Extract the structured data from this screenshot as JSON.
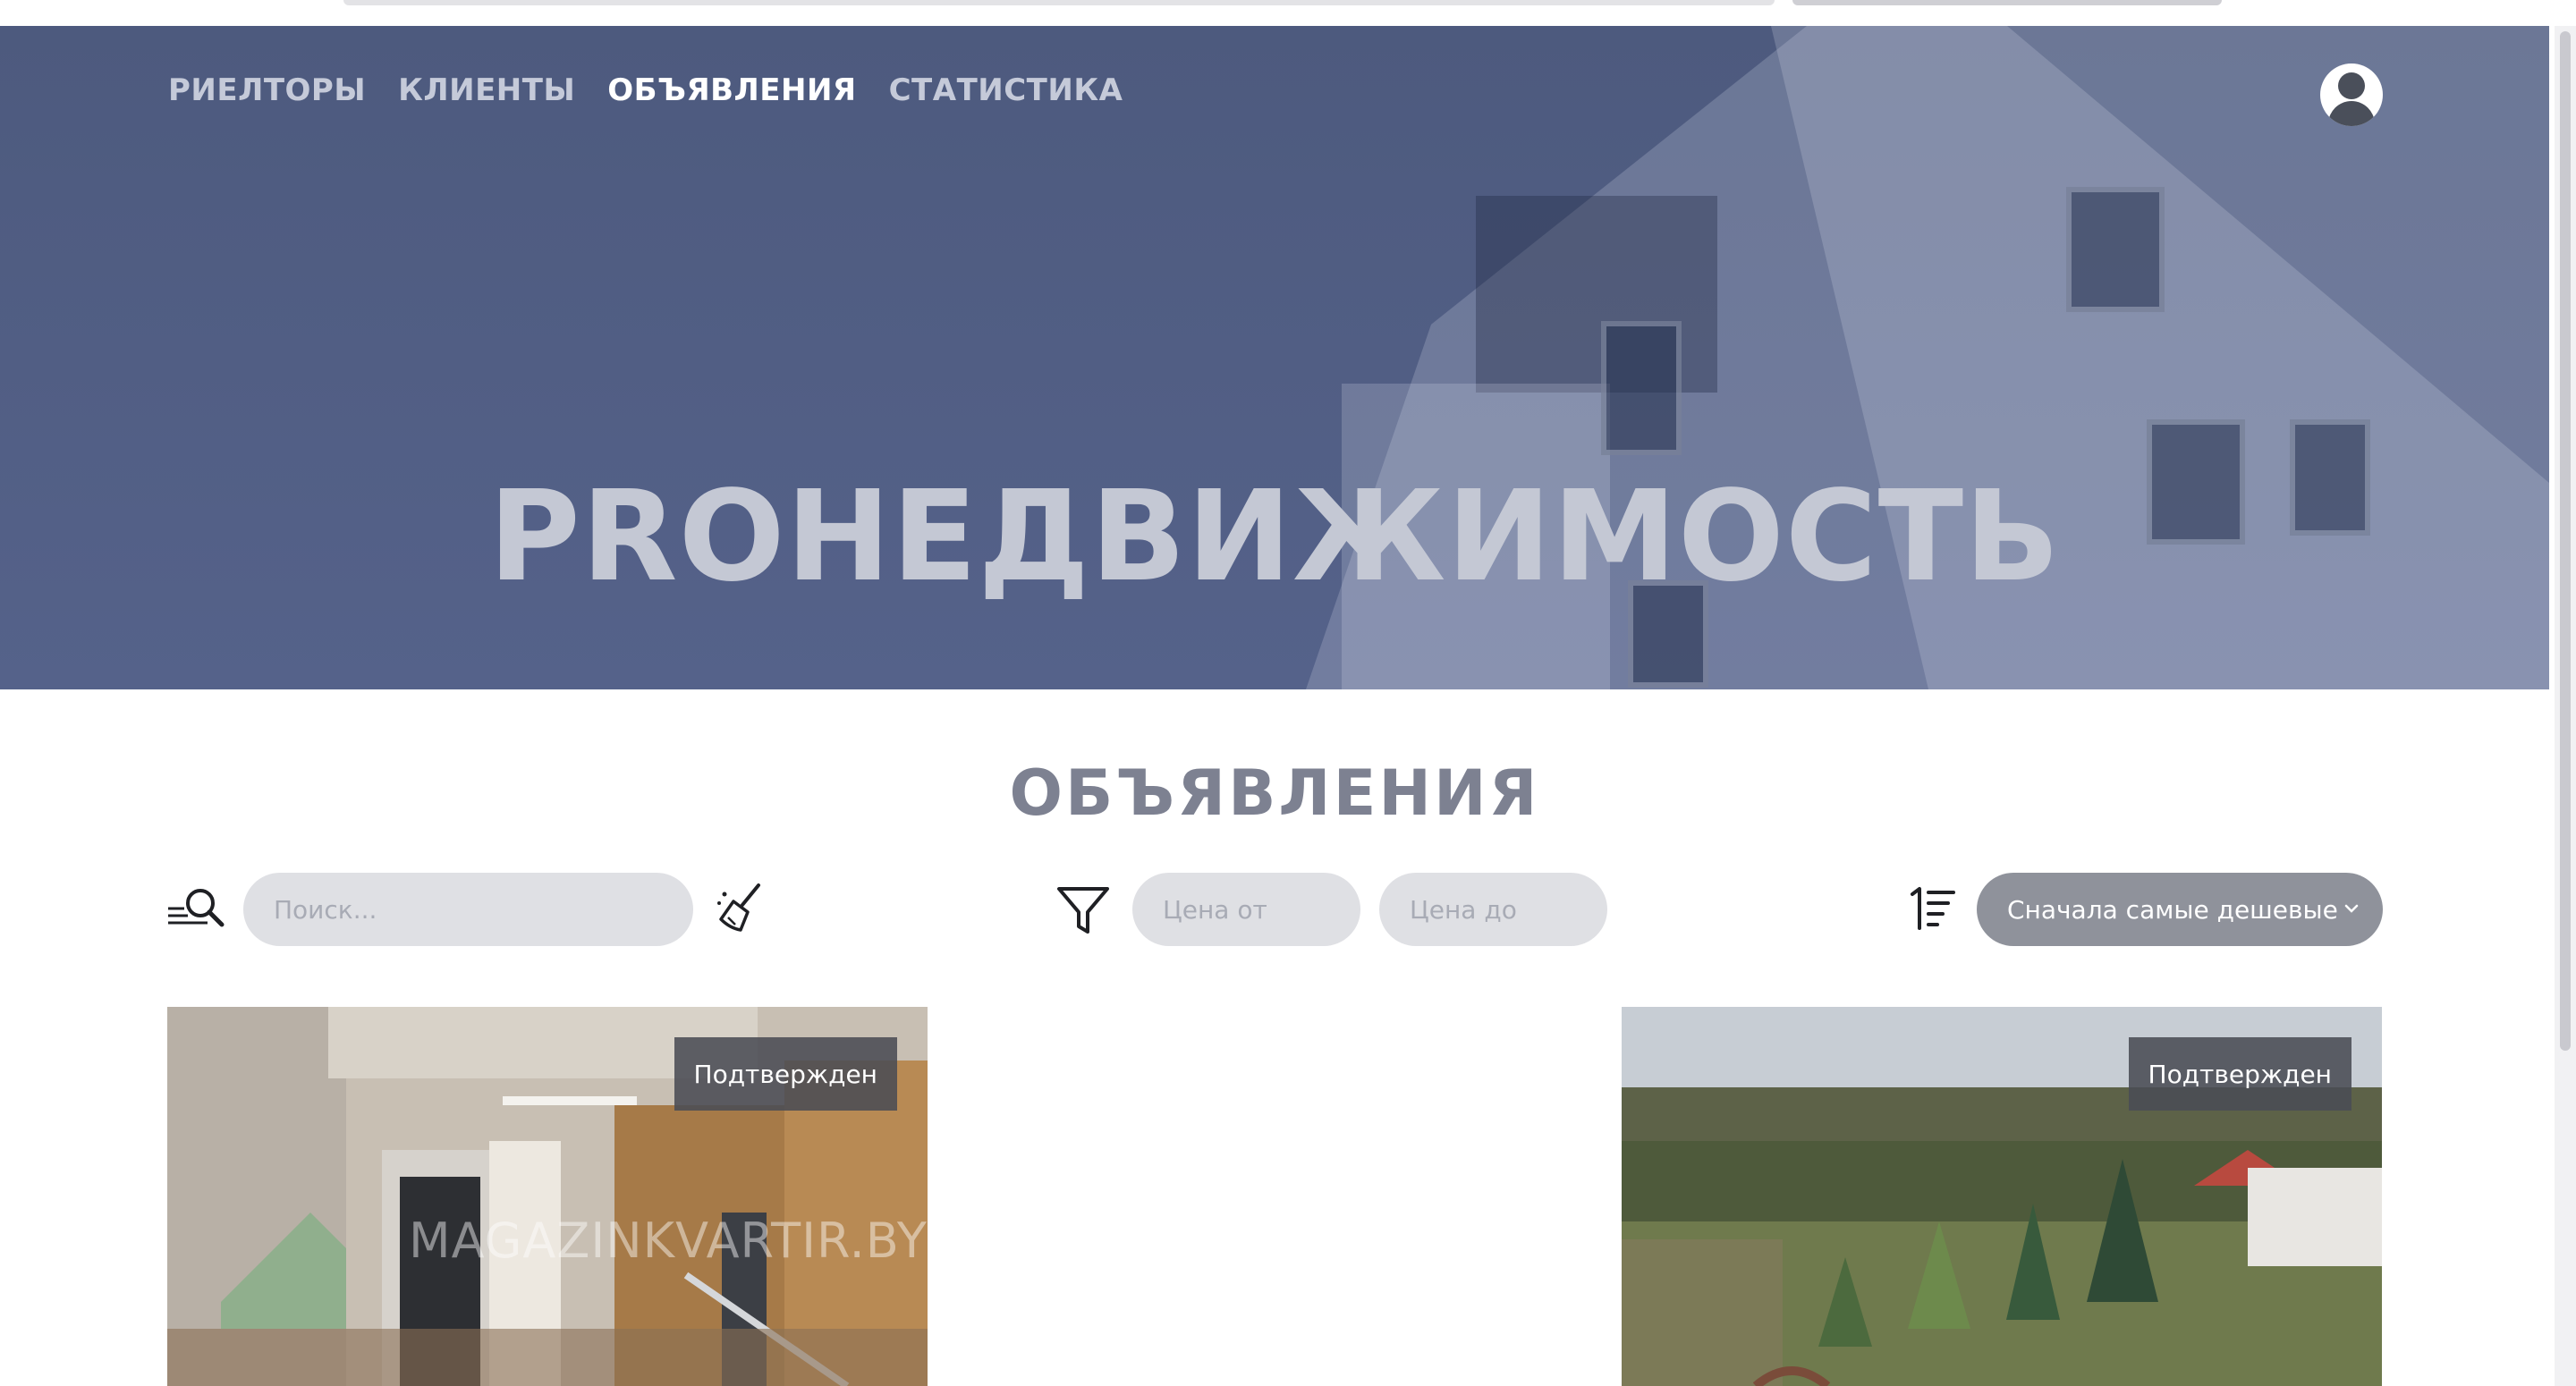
{
  "nav": {
    "items": [
      {
        "label": "РИЕЛТОРЫ"
      },
      {
        "label": "КЛИЕНТЫ"
      },
      {
        "label": "ОБЪЯВЛЕНИЯ"
      },
      {
        "label": "СТАТИСТИКА"
      }
    ],
    "active_label": "ОБЪЯВЛЕНИЯ"
  },
  "hero": {
    "brand_text": "PROНЕДВИЖИМОСТЬ"
  },
  "section": {
    "title": "ОБЪЯВЛЕНИЯ"
  },
  "search": {
    "placeholder": "Поиск...",
    "icon": "search-icon"
  },
  "filters": {
    "icon": "filter-icon",
    "price_from_placeholder": "Цена от",
    "price_to_placeholder": "Цена до"
  },
  "sort": {
    "icon": "sort-icon",
    "selected": "Сначала самые дешевые"
  },
  "listings": [
    {
      "status": "Подтвержден",
      "watermark": "MAGAZINKVARTIR.BY",
      "image": "apartment-hallway-photo"
    },
    {
      "status": "Подтвержден",
      "image": "garden-forest-photo"
    }
  ],
  "colors": {
    "hero_overlay": "#4d5a7e",
    "control_bg": "#dfe0e4",
    "sort_bg": "#8f929b",
    "title_color": "#7d8191"
  }
}
